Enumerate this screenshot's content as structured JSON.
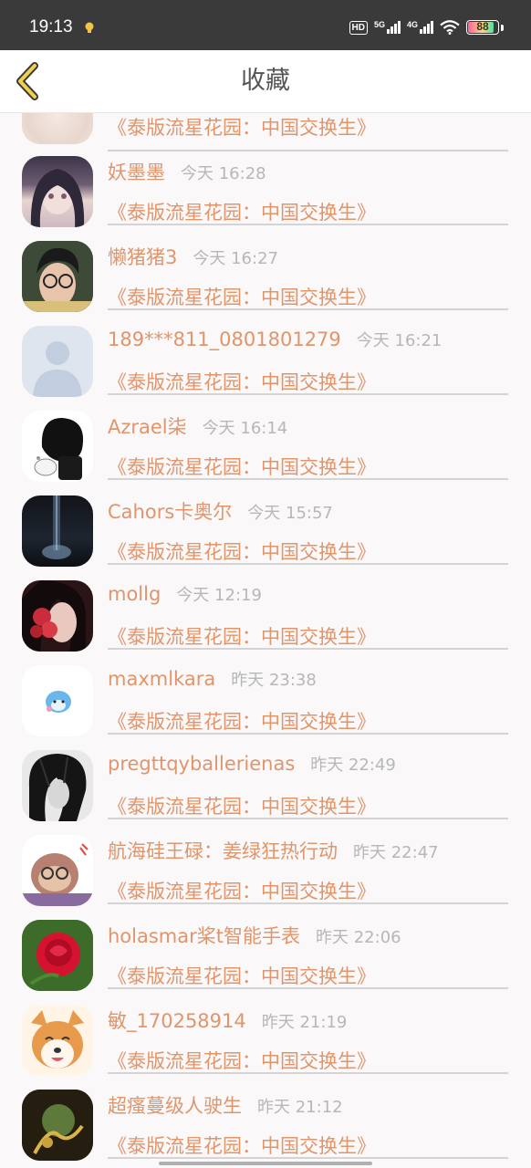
{
  "status": {
    "time": "19:13",
    "hd": "HD",
    "net1": "5G",
    "net2": "4G",
    "battery": "88"
  },
  "header": {
    "title": "收藏"
  },
  "partial_item": {
    "title": "《泰版流星花园：中国交换生》"
  },
  "items": [
    {
      "user": "妖墨墨",
      "time": "今天 16:28",
      "title": "《泰版流星花园：中国交换生》"
    },
    {
      "user": "懒猪猪3",
      "time": "今天 16:27",
      "title": "《泰版流星花园：中国交换生》"
    },
    {
      "user": "189***811_0801801279",
      "time": "今天 16:21",
      "title": "《泰版流星花园：中国交换生》"
    },
    {
      "user": "Azrael柒",
      "time": "今天 16:14",
      "title": "《泰版流星花园：中国交换生》"
    },
    {
      "user": "Cahors卡奥尔",
      "time": "今天 15:57",
      "title": "《泰版流星花园：中国交换生》"
    },
    {
      "user": "mollg",
      "time": "今天 12:19",
      "title": "《泰版流星花园：中国交换生》"
    },
    {
      "user": "maxmlkara",
      "time": "昨天 23:38",
      "title": "《泰版流星花园：中国交换生》"
    },
    {
      "user": "pregttqyballerienas",
      "time": "昨天 22:49",
      "title": "《泰版流星花园：中国交换生》"
    },
    {
      "user": "航海硅王碌：姜绿狂热行动",
      "time": "昨天 22:47",
      "title": "《泰版流星花园：中国交换生》"
    },
    {
      "user": "holasmar桨t智能手表",
      "time": "昨天 22:06",
      "title": "《泰版流星花园：中国交换生》"
    },
    {
      "user": "敏_170258914",
      "time": "昨天 21:19",
      "title": "《泰版流星花园：中国交换生》"
    },
    {
      "user": "超瘙蔓级人驶生",
      "time": "昨天 21:12",
      "title": "《泰版流星花园：中国交换生》"
    }
  ]
}
